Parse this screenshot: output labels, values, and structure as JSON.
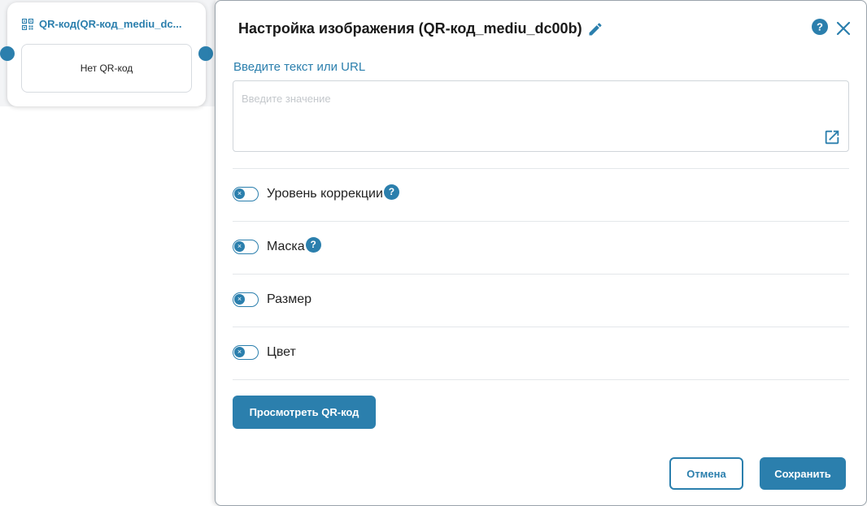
{
  "node": {
    "title": "QR-код(QR-код_mediu_dc...",
    "body_text": "Нет QR-код",
    "icon": "qr-code-icon"
  },
  "dialog": {
    "title": "Настройка изображения (QR-код_mediu_dc00b)",
    "icons": [
      "edit-icon",
      "help-icon",
      "close-icon"
    ],
    "url_label": "Введите текст или URL",
    "url_input": {
      "value": "",
      "placeholder": "Введите значение",
      "icon": "open-external-icon"
    },
    "options": [
      {
        "label": "Уровень коррекции",
        "enabled": false,
        "has_help": true
      },
      {
        "label": "Маска",
        "enabled": false,
        "has_help": true
      },
      {
        "label": "Размер",
        "enabled": false,
        "has_help": false
      },
      {
        "label": "Цвет",
        "enabled": false,
        "has_help": false
      }
    ],
    "help_badge": "?",
    "toggle_knob": "×",
    "preview_button": "Просмотреть QR-код",
    "cancel_button": "Отмена",
    "save_button": "Сохранить"
  },
  "colors": {
    "accent": "#2b7fad",
    "border": "#d0d5da",
    "divider": "#e4e7ea"
  }
}
